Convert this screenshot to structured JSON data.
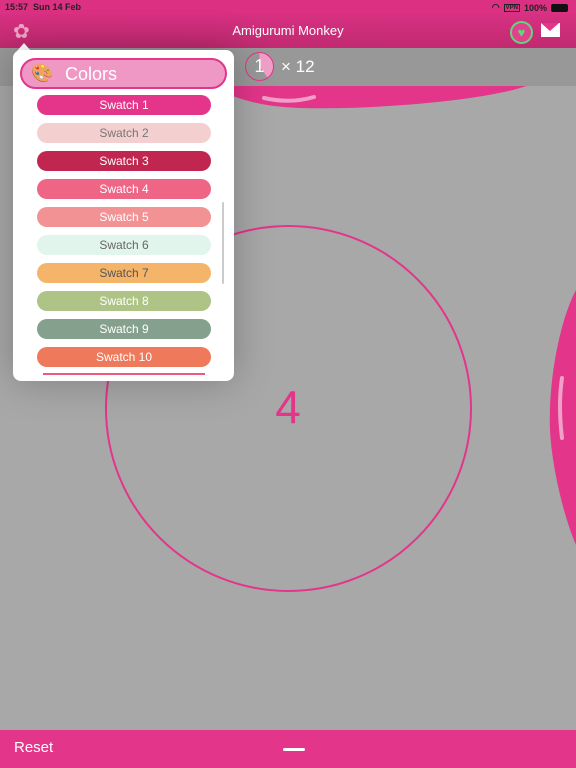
{
  "status": {
    "time": "15:57",
    "date": "Sun 14 Feb",
    "vpn": "VPN",
    "battery": "100%"
  },
  "header": {
    "title": "Amigurumi Monkey",
    "settings_icon": "gear-icon",
    "favorite_icon": "heart-icon",
    "mail_icon": "envelope-icon"
  },
  "counter": {
    "current": "1",
    "multiplier": "× 12",
    "progress_fraction": 0.4
  },
  "main": {
    "stitch_count": "4"
  },
  "footer": {
    "reset_label": "Reset"
  },
  "popover": {
    "heading": "Colors",
    "icon": "palette-icon",
    "swatches": [
      {
        "label": "Swatch 1",
        "color": "#e5358a",
        "text": "#ffffff"
      },
      {
        "label": "Swatch 2",
        "color": "#f4cfd0",
        "text": "#777777"
      },
      {
        "label": "Swatch 3",
        "color": "#c0264f",
        "text": "#ffffff"
      },
      {
        "label": "Swatch 4",
        "color": "#ef6585",
        "text": "#ffffff"
      },
      {
        "label": "Swatch 5",
        "color": "#f29295",
        "text": "#ffffff"
      },
      {
        "label": "Swatch 6",
        "color": "#e2f5ec",
        "text": "#666666"
      },
      {
        "label": "Swatch 7",
        "color": "#f4b56b",
        "text": "#555555"
      },
      {
        "label": "Swatch 8",
        "color": "#adc486",
        "text": "#ffffff"
      },
      {
        "label": "Swatch 9",
        "color": "#85a08c",
        "text": "#ffffff"
      },
      {
        "label": "Swatch 10",
        "color": "#ef795b",
        "text": "#ffffff"
      }
    ]
  },
  "colors": {
    "accent": "#e3358a",
    "background": "#a8a8a8"
  }
}
